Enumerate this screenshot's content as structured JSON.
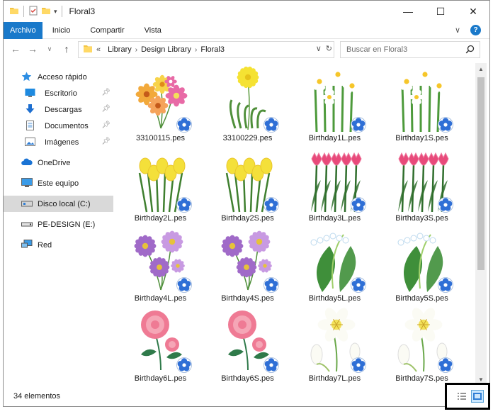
{
  "window": {
    "title": "Floral3",
    "controls": {
      "minimize": "—",
      "maximize": "☐",
      "close": "✕"
    }
  },
  "ribbon": {
    "tabs": [
      "Archivo",
      "Inicio",
      "Compartir",
      "Vista"
    ],
    "expand": "∨",
    "help": "?"
  },
  "address": {
    "back": "←",
    "forward": "→",
    "recent": "∨",
    "up": "↑",
    "overflow": "«",
    "crumbs": [
      "Library",
      "Design Library",
      "Floral3"
    ],
    "refresh": "↻"
  },
  "search": {
    "placeholder": "Buscar en Floral3"
  },
  "sidebar": {
    "items": [
      {
        "label": "Acceso rápido",
        "icon": "star-icon",
        "pinned": false
      },
      {
        "label": "Escritorio",
        "icon": "desktop-icon",
        "pinned": true
      },
      {
        "label": "Descargas",
        "icon": "download-icon",
        "pinned": true
      },
      {
        "label": "Documentos",
        "icon": "document-icon",
        "pinned": true
      },
      {
        "label": "Imágenes",
        "icon": "pictures-icon",
        "pinned": true
      },
      {
        "label": "OneDrive",
        "icon": "cloud-icon",
        "pinned": false
      },
      {
        "label": "Este equipo",
        "icon": "computer-icon",
        "pinned": false
      },
      {
        "label": "Disco local (C:)",
        "icon": "drive-icon",
        "pinned": false,
        "selected": true
      },
      {
        "label": "PE-DESIGN (E:)",
        "icon": "usb-drive-icon",
        "pinned": false
      },
      {
        "label": "Red",
        "icon": "network-icon",
        "pinned": false
      }
    ]
  },
  "files": [
    {
      "name": "33100115.pes",
      "kind": "bouquet",
      "colors": [
        "#f2a93b",
        "#e86aa6",
        "#f7d34a"
      ]
    },
    {
      "name": "33100229.pes",
      "kind": "dandelion",
      "colors": [
        "#f5e233",
        "#4f8f3a",
        "#6ea84a"
      ]
    },
    {
      "name": "Birthday1L.pes",
      "kind": "narcissus",
      "colors": [
        "#ffffff",
        "#f6c62a",
        "#4d9a3b"
      ]
    },
    {
      "name": "Birthday1S.pes",
      "kind": "narcissus",
      "colors": [
        "#ffffff",
        "#f6c62a",
        "#4d9a3b"
      ]
    },
    {
      "name": "Birthday2L.pes",
      "kind": "freesia",
      "colors": [
        "#f4e03a",
        "#e9c62c",
        "#3f7f2f"
      ]
    },
    {
      "name": "Birthday2S.pes",
      "kind": "freesia",
      "colors": [
        "#f4e03a",
        "#e9c62c",
        "#3f7f2f"
      ]
    },
    {
      "name": "Birthday3L.pes",
      "kind": "tulip",
      "colors": [
        "#e84a7a",
        "#f07aa0",
        "#2f6e2c"
      ]
    },
    {
      "name": "Birthday3S.pes",
      "kind": "tulip",
      "colors": [
        "#e84a7a",
        "#f07aa0",
        "#2f6e2c"
      ]
    },
    {
      "name": "Birthday4L.pes",
      "kind": "aster",
      "colors": [
        "#a06ac8",
        "#c89ae2",
        "#e6c23a"
      ]
    },
    {
      "name": "Birthday4S.pes",
      "kind": "aster",
      "colors": [
        "#a06ac8",
        "#c89ae2",
        "#e6c23a"
      ]
    },
    {
      "name": "Birthday5L.pes",
      "kind": "lily-of-valley",
      "colors": [
        "#ffffff",
        "#3f8f3a",
        "#9fcf6a"
      ]
    },
    {
      "name": "Birthday5S.pes",
      "kind": "lily-of-valley",
      "colors": [
        "#ffffff",
        "#3f8f3a",
        "#9fcf6a"
      ]
    },
    {
      "name": "Birthday6L.pes",
      "kind": "rose",
      "colors": [
        "#ef7a94",
        "#f5a6b6",
        "#2f7a4a"
      ]
    },
    {
      "name": "Birthday6S.pes",
      "kind": "rose",
      "colors": [
        "#ef7a94",
        "#f5a6b6",
        "#2f7a4a"
      ]
    },
    {
      "name": "Birthday7L.pes",
      "kind": "lily",
      "colors": [
        "#fbfbf4",
        "#f2e25a",
        "#9fc36a"
      ]
    },
    {
      "name": "Birthday7S.pes",
      "kind": "lily",
      "colors": [
        "#fbfbf4",
        "#f2e25a",
        "#9fc36a"
      ]
    }
  ],
  "status": {
    "count": "34 elementos"
  },
  "view": {
    "active": "large-icons"
  },
  "colors": {
    "accent": "#1979ca",
    "badge": "#2f6fd6"
  }
}
